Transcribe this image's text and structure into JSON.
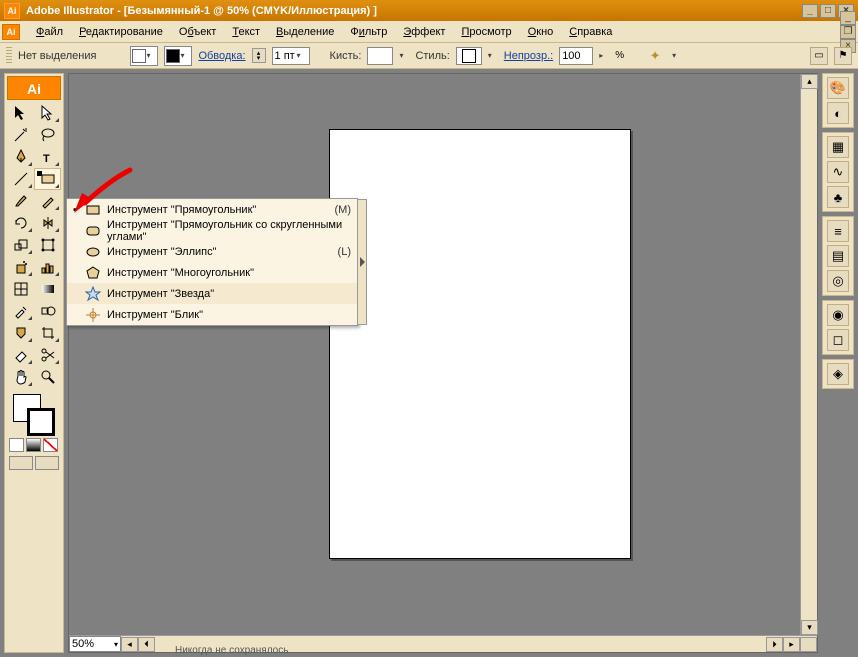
{
  "titlebar": {
    "app_name": "Adobe Illustrator",
    "doc_name": "[Безымянный-1 @ 50% (CMYK/Иллюстрация) ]",
    "ai_badge": "Ai"
  },
  "menu": {
    "items": [
      "Файл",
      "Редактирование",
      "Объект",
      "Текст",
      "Выделение",
      "Фильтр",
      "Эффект",
      "Просмотр",
      "Окно",
      "Справка"
    ],
    "logo": "Ai"
  },
  "options": {
    "selection": "Нет выделения",
    "stroke_label": "Обводка:",
    "stroke_value": "1 пт",
    "brush_label": "Кисть:",
    "style_label": "Стиль:",
    "opacity_label": "Непрозр.:",
    "opacity_value": "100",
    "percent": "%"
  },
  "flyout": {
    "items": [
      {
        "label": "Инструмент \"Прямоугольник\"",
        "key": "(M)",
        "icon": "rect"
      },
      {
        "label": "Инструмент \"Прямоугольник со скругленными углами\"",
        "key": "",
        "icon": "roundrect"
      },
      {
        "label": "Инструмент \"Эллипс\"",
        "key": "(L)",
        "icon": "ellipse"
      },
      {
        "label": "Инструмент \"Многоугольник\"",
        "key": "",
        "icon": "polygon"
      },
      {
        "label": "Инструмент \"Звезда\"",
        "key": "",
        "icon": "star"
      },
      {
        "label": "Инструмент \"Блик\"",
        "key": "",
        "icon": "flare"
      }
    ]
  },
  "status": {
    "zoom": "50%",
    "save": "Никогда не сохранялось"
  }
}
